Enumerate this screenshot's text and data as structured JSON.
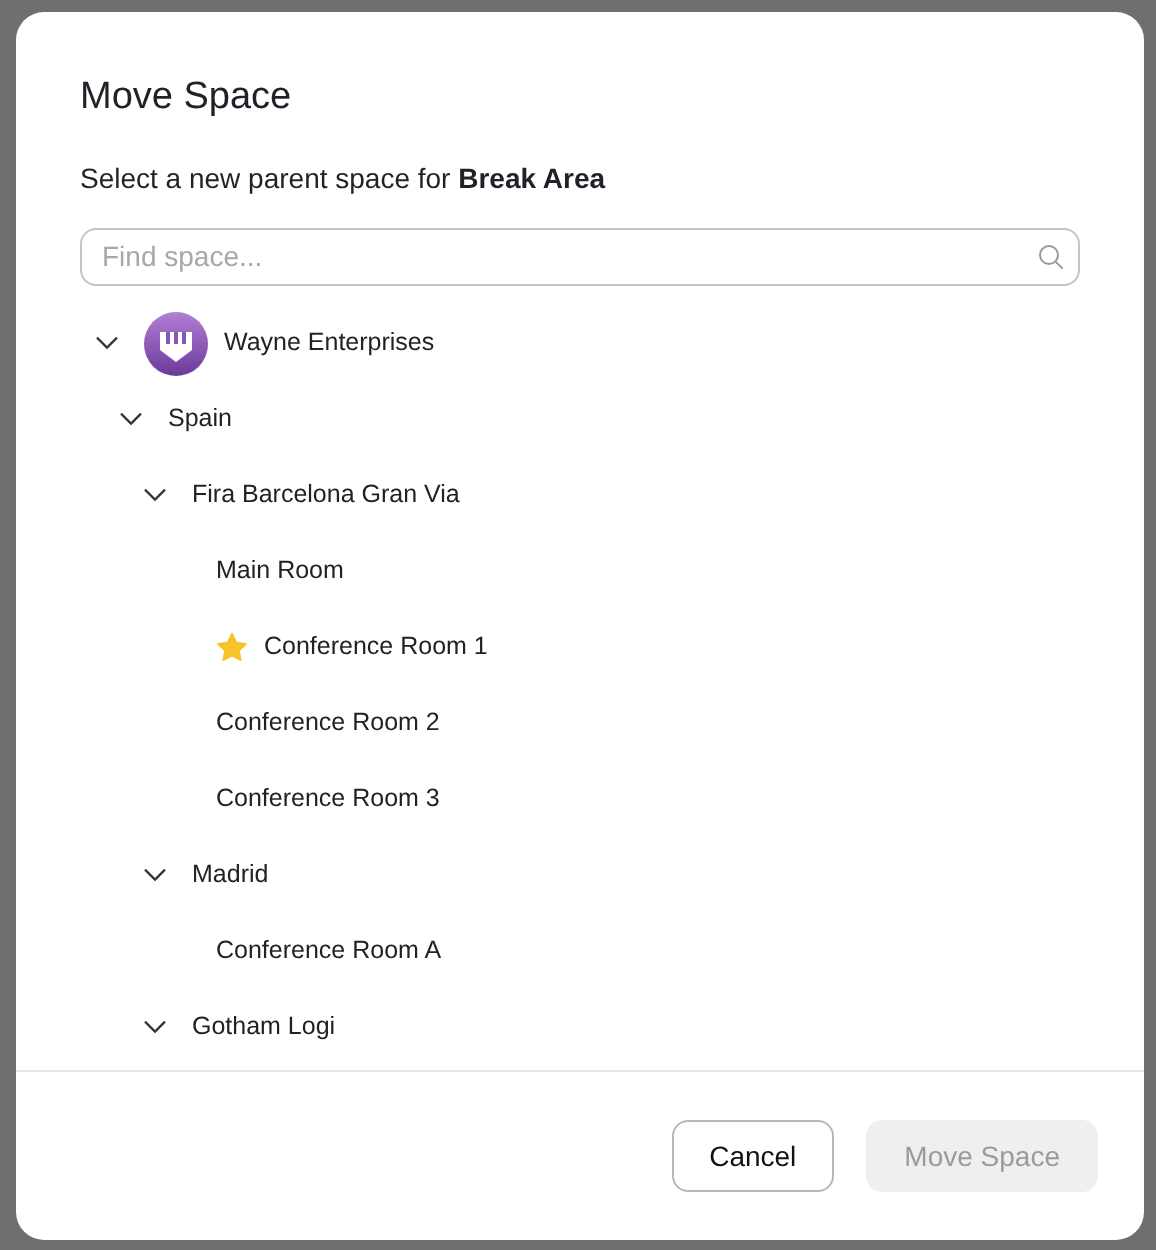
{
  "dialog": {
    "title": "Move Space",
    "subtitle": "Select a new parent space for **Break Area**",
    "search": {
      "placeholder": "Find space..."
    },
    "tree": [
      {
        "label": "Wayne Enterprises",
        "kind": "organization",
        "expanded": true,
        "children": [
          {
            "label": "Spain",
            "expanded": true,
            "children": [
              {
                "label": "Fira Barcelona Gran Via",
                "expanded": true,
                "children": [
                  {
                    "label": "Main Room",
                    "starred": false
                  },
                  {
                    "label": "Conference Room 1",
                    "starred": true
                  },
                  {
                    "label": "Conference Room 2",
                    "starred": false
                  },
                  {
                    "label": "Conference Room 3",
                    "starred": false
                  }
                ]
              },
              {
                "label": "Madrid",
                "expanded": true,
                "children": [
                  {
                    "label": "Conference Room A",
                    "starred": false
                  }
                ]
              },
              {
                "label": "Gotham Logi",
                "expanded": true
              }
            ]
          }
        ]
      }
    ],
    "buttons": [
      {
        "label": "Cancel",
        "kind": "secondary",
        "disabled": false
      },
      {
        "label": "Move Space",
        "kind": "primary",
        "disabled": true
      }
    ]
  }
}
